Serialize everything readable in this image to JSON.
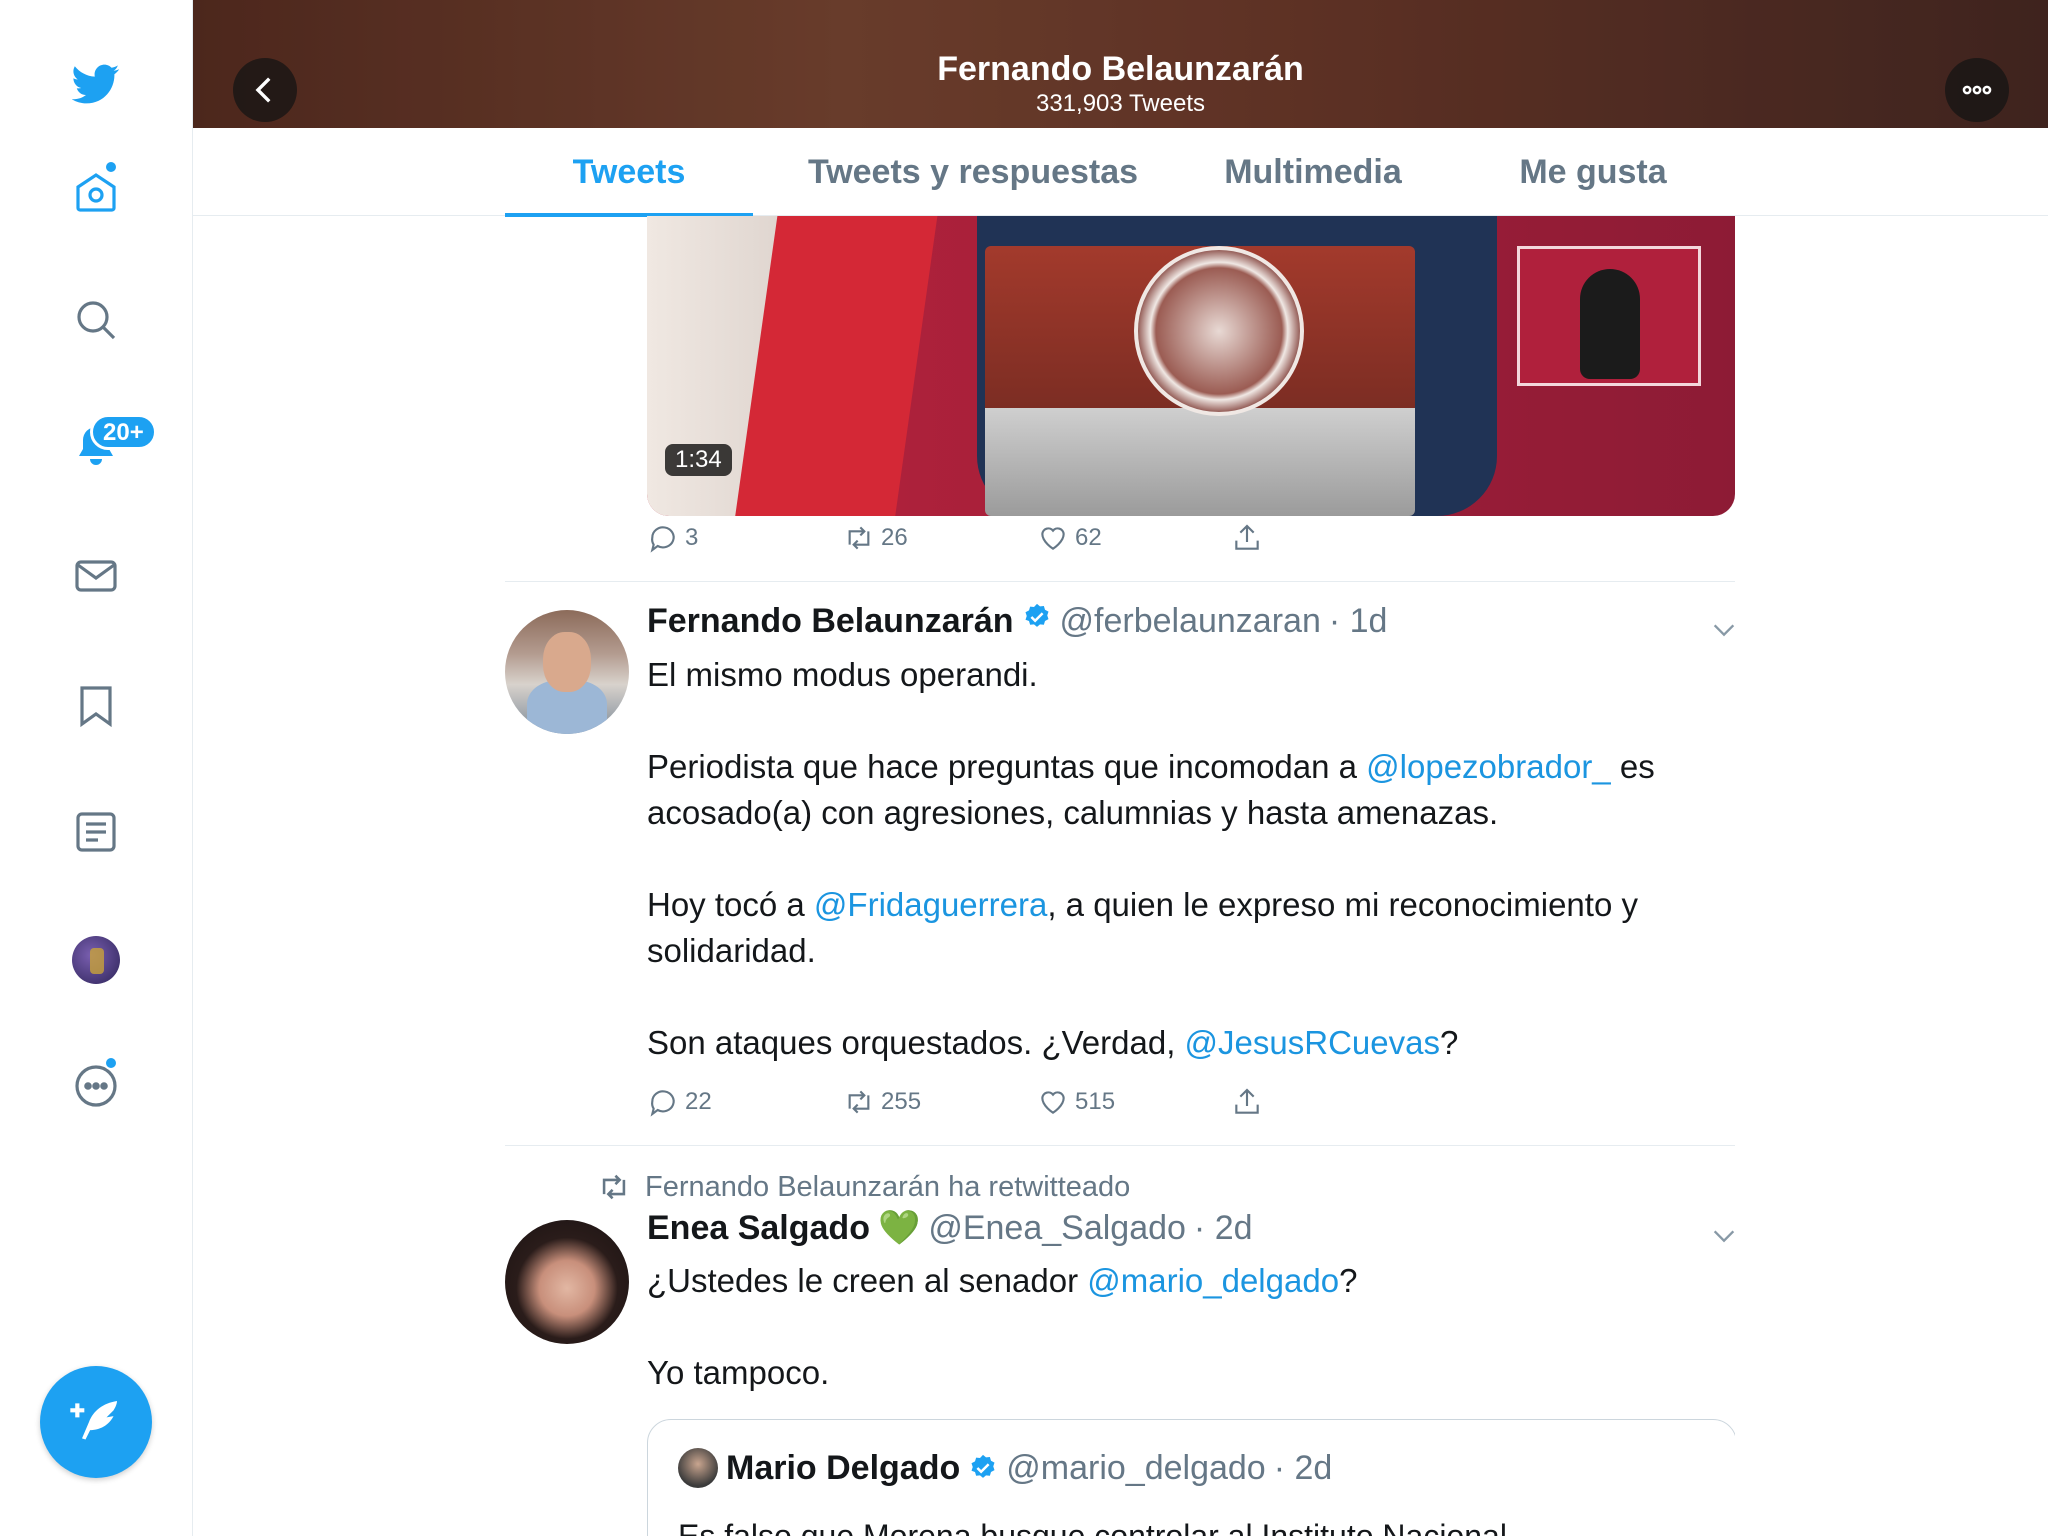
{
  "colors": {
    "accent": "#1da1f2",
    "text": "#14171a",
    "muted": "#657786",
    "border": "#e6ecf0"
  },
  "sidebar": {
    "items": [
      {
        "name": "twitter-logo",
        "icon": "twitter-bird-icon"
      },
      {
        "name": "home",
        "icon": "home-icon"
      },
      {
        "name": "explore",
        "icon": "search-icon"
      },
      {
        "name": "notifications",
        "icon": "bell-icon",
        "badge": "20+"
      },
      {
        "name": "messages",
        "icon": "mail-icon"
      },
      {
        "name": "bookmarks",
        "icon": "bookmark-icon"
      },
      {
        "name": "lists",
        "icon": "list-icon"
      },
      {
        "name": "profile",
        "icon": "avatar"
      },
      {
        "name": "more",
        "icon": "more-icon"
      }
    ],
    "compose_icon": "feather-plus-icon"
  },
  "header": {
    "title": "Fernando Belaunzarán",
    "subtitle": "331,903 Tweets"
  },
  "tabs": [
    {
      "label": "Tweets",
      "active": true
    },
    {
      "label": "Tweets y respuestas",
      "active": false
    },
    {
      "label": "Multimedia",
      "active": false
    },
    {
      "label": "Me gusta",
      "active": false
    }
  ],
  "tweets": [
    {
      "video_duration": "1:34",
      "stats": {
        "replies": "3",
        "retweets": "26",
        "likes": "62"
      }
    },
    {
      "name": "Fernando Belaunzarán",
      "handle": "@ferbelaunzaran",
      "time": "· 1d",
      "p1": "El mismo modus operandi.",
      "p2_a": "Periodista que hace preguntas que incomodan a ",
      "p2_mention": "@lopezobrador_",
      "p2_b": " es acosado(a) con agresiones, calumnias y hasta amenazas.",
      "p3_a": "Hoy tocó a ",
      "p3_mention": "@Fridaguerrera",
      "p3_b": ", a quien le expreso mi reconocimiento y solidaridad.",
      "p4_a": "Son ataques orquestados. ¿Verdad, ",
      "p4_mention": "@JesusRCuevas",
      "p4_b": "?",
      "stats": {
        "replies": "22",
        "retweets": "255",
        "likes": "515"
      }
    },
    {
      "retweeted_by": "Fernando Belaunzarán ha retwitteado",
      "name": "Enea Salgado",
      "emoji": "💚",
      "handle": "@Enea_Salgado",
      "time": "· 2d",
      "p1_a": "¿Ustedes le creen al senador ",
      "p1_mention": "@mario_delgado",
      "p1_b": "?",
      "p2": "Yo tampoco.",
      "quote": {
        "name": "Mario Delgado",
        "handle": "@mario_delgado",
        "time": "· 2d",
        "text": "Es falso que Morena busque controlar al Instituto Nacional"
      }
    }
  ]
}
